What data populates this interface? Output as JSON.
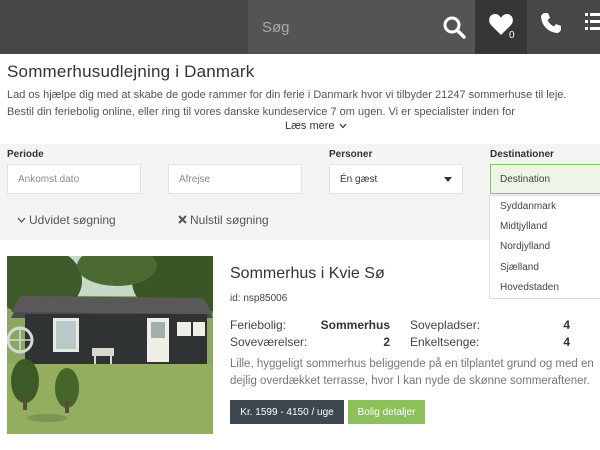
{
  "header": {
    "search_placeholder": "Søg",
    "favorites_count": "0"
  },
  "intro": {
    "title": "Sommerhusudlejning i Danmark",
    "line1": "Lad os hjælpe dig med at skabe de gode rammer for din ferie i Danmark hvor vi tilbyder 21247 sommerhuse til leje.",
    "line2": "Bestil din feriebolig online, eller ring til vores danske kundeservice 7 om ugen. Vi er specialister inden for",
    "read_more": "Læs mere"
  },
  "filter": {
    "periode_label": "Periode",
    "arrival_placeholder": "Ankomst dato",
    "departure_placeholder": "Afrejse",
    "persons_label": "Personer",
    "persons_value": "Én gæst",
    "destinations_label": "Destinationer",
    "destination_value": "Destination",
    "advanced_search": "Udvidet søgning",
    "reset_search": "Nulstil søgning",
    "destination_options": [
      "Syddanmark",
      "Midtjylland",
      "Nordjylland",
      "Sjælland",
      "Hovedstaden"
    ]
  },
  "listing": {
    "title": "Sommerhus i Kvie Sø",
    "id_text": "id: nsp85006",
    "feriebolig_label": "Feriebolig:",
    "feriebolig_value": "Sommerhus",
    "sovevaerelser_label": "Soveværelser:",
    "sovevaerelser_value": "2",
    "sovepladser_label": "Sovepladser:",
    "sovepladser_value": "4",
    "enkeltsenge_label": "Enkeltsenge:",
    "enkeltsenge_value": "4",
    "desc_line1": "Lille, hyggeligt sommerhus beliggende på en tilplantet grund og med en",
    "desc_line2": "dejlig overdækket terrasse, hvor I kan nyde de skønne sommeraftener.",
    "price": "Kr. 1599 - 4150 / uge",
    "details_button": "Bolig detaljer"
  },
  "colors": {
    "topbar": "#474747",
    "accent_green": "#8cc05a",
    "price_button": "#3d4750"
  }
}
